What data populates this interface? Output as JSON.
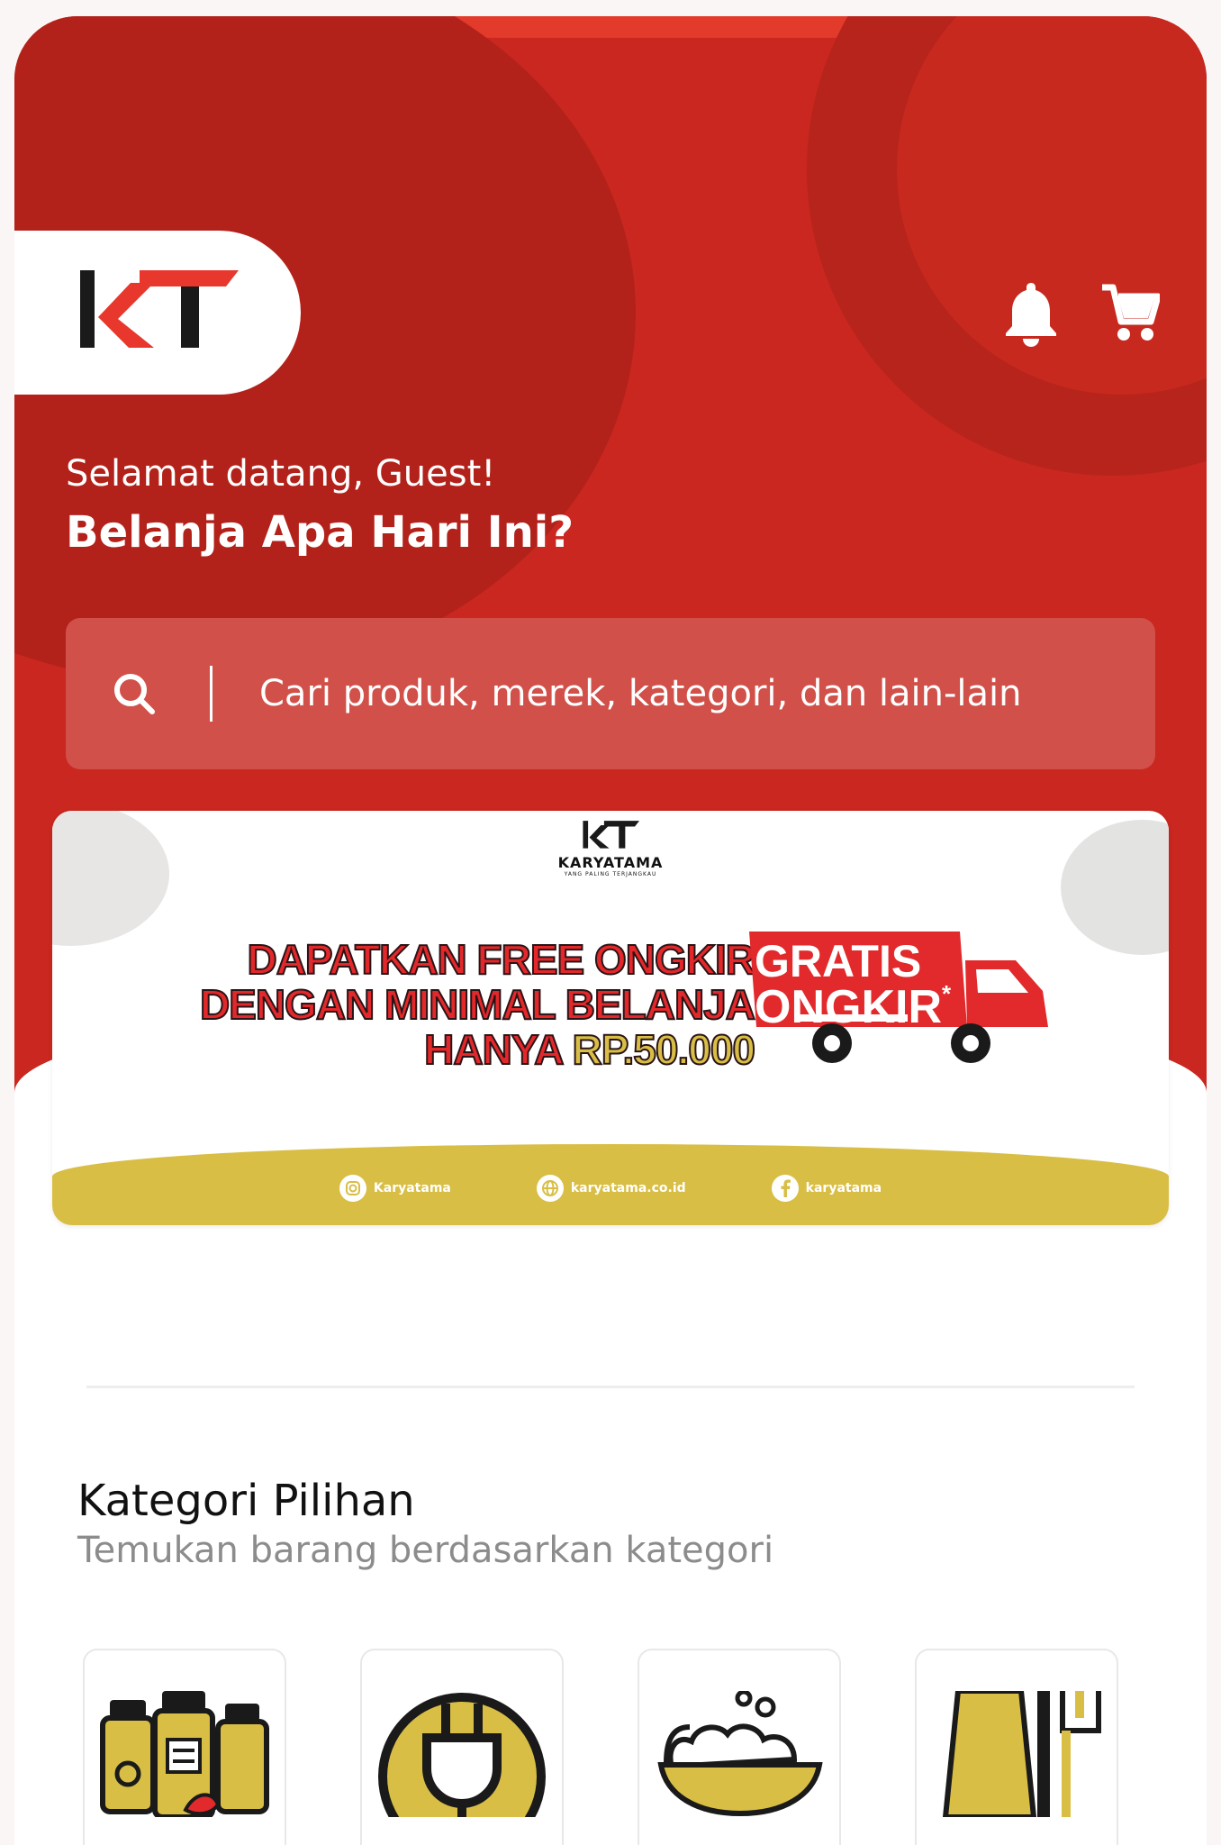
{
  "header": {
    "logo_text": "KT",
    "greeting": "Selamat datang, Guest!",
    "headline": "Belanja Apa Hari Ini?"
  },
  "icons": {
    "notification": "bell-icon",
    "cart": "cart-icon",
    "search": "search-icon"
  },
  "search": {
    "placeholder": "Cari produk, merek, kategori, dan lain-lain"
  },
  "banner": {
    "brand": "KARYATAMA",
    "tagline": "YANG PALING TERJANGKAU",
    "line1": "DAPATKAN FREE ONGKIR",
    "line2": "DENGAN MINIMAL BELANJA",
    "line3_word": "HANYA",
    "line3_price": "RP.50.000",
    "badge_line1": "GRATIS",
    "badge_line2": "ONGKIR",
    "badge_mark": "*",
    "social": [
      {
        "icon": "instagram-icon",
        "label": "Karyatama"
      },
      {
        "icon": "web-icon",
        "label": "karyatama.co.id"
      },
      {
        "icon": "facebook-icon",
        "label": "karyatama"
      }
    ]
  },
  "categories": {
    "title": "Kategori Pilihan",
    "subtitle": "Temukan barang berdasarkan kategori",
    "items": [
      {
        "icon": "spice-bottles-icon"
      },
      {
        "icon": "electric-plug-icon"
      },
      {
        "icon": "rice-bowl-icon"
      },
      {
        "icon": "kitchen-tools-icon"
      }
    ]
  },
  "colors": {
    "primary": "#c9271f",
    "accent": "#d9be45",
    "promo_red": "#e2282b"
  }
}
